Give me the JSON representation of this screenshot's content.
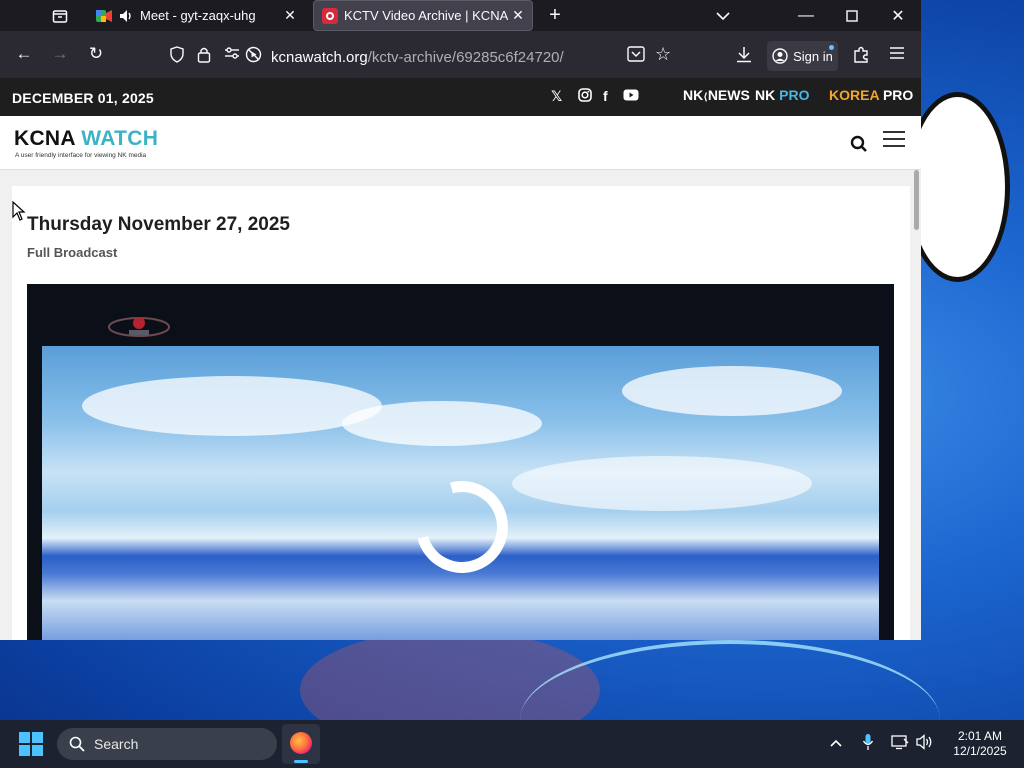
{
  "browser": {
    "tabs": [
      {
        "label": "Meet - gyt-zaqx-uhg",
        "active": false
      },
      {
        "label": "KCTV Video Archive | KCNA Wat",
        "active": true
      }
    ],
    "url_domain": "kcnawatch.org",
    "url_path": "/kctv-archive/69285c6f24720/",
    "signin_label": "Sign in"
  },
  "site": {
    "date": "DECEMBER 01, 2025",
    "brands": {
      "nknews_nk": "NK",
      "nknews_news": "NEWS",
      "nkpro_nk": "NK ",
      "nkpro_pro": "PRO",
      "korea": "KOREA ",
      "korea_pro": "PRO"
    },
    "logo_kcna": "KCNA",
    "logo_watch": " WATCH",
    "logo_tagline": "A user friendly interface for viewing NK media"
  },
  "main": {
    "title": "Thursday November 27, 2025",
    "subtitle": "Full Broadcast"
  },
  "taskbar": {
    "search_placeholder": "Search",
    "time": "2:01 AM",
    "date": "12/1/2025"
  },
  "colors": {
    "accent_teal": "#3ab3c7",
    "nkpro_blue": "#45b8e6",
    "korea_orange": "#f4a62a",
    "firefox_highlight": "#4cc2ff"
  }
}
